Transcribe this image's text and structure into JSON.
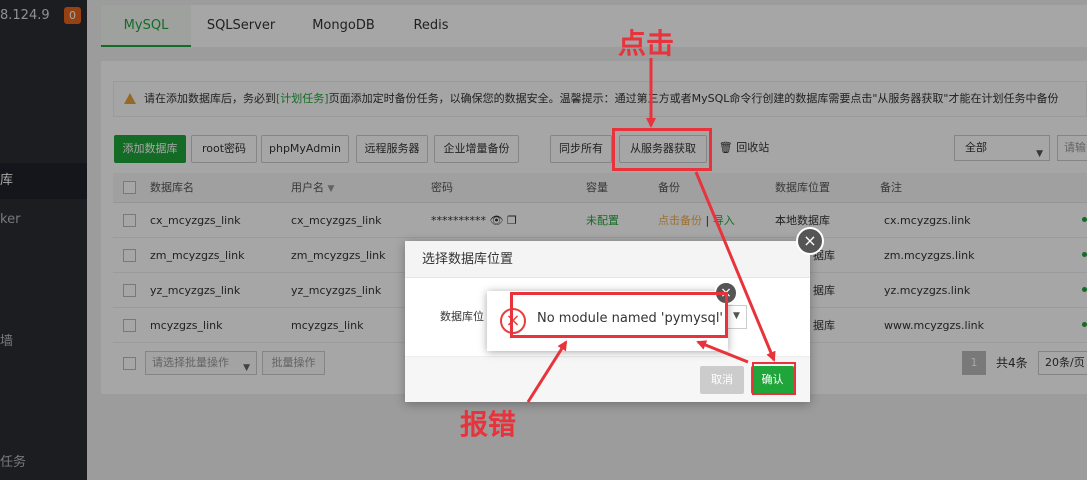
{
  "sidebar": {
    "ip": "8.124.9",
    "badge": "0",
    "items": [
      {
        "label": "库"
      },
      {
        "label": "ker"
      },
      {
        "label": "墙"
      },
      {
        "label": "任务"
      }
    ]
  },
  "tabs": [
    {
      "label": "MySQL"
    },
    {
      "label": "SQLServer"
    },
    {
      "label": "MongoDB"
    },
    {
      "label": "Redis"
    }
  ],
  "warning": {
    "prefix": "请在添加数据库后，务必到",
    "link": "[计划任务]",
    "suffix": "页面添加定时备份任务，以确保您的数据安全。温馨提示：通过第三方或者MySQL命令行创建的数据库需要点击\"从服务器获取\"才能在计划任务中备份"
  },
  "toolbar": {
    "add_db": "添加数据库",
    "root_pwd": "root密码",
    "phpmyadmin": "phpMyAdmin",
    "remote_server": "远程服务器",
    "enterprise_backup": "企业增量备份",
    "sync_all": "同步所有",
    "fetch_from_server": "从服务器获取",
    "recycle_bin": "回收站",
    "filter_all": "全部",
    "search_placeholder": "请输"
  },
  "table": {
    "headers": {
      "name": "数据库名",
      "user": "用户名",
      "password": "密码",
      "capacity": "容量",
      "backup": "备份",
      "location": "数据库位置",
      "note": "备注"
    },
    "rows": [
      {
        "name": "cx_mcyzgzs_link",
        "user": "cx_mcyzgzs_link",
        "password": "**********",
        "capacity": "未配置",
        "backup": "点击备份",
        "sep": "|",
        "import": "导入",
        "location": "本地数据库",
        "note": "cx.mcyzgzs.link"
      },
      {
        "name": "zm_mcyzgzs_link",
        "user": "zm_mcyzgzs_link",
        "location": "据库",
        "note": "zm.mcyzgzs.link"
      },
      {
        "name": "yz_mcyzgzs_link",
        "user": "yz_mcyzgzs_link",
        "location": "据库",
        "note": "yz.mcyzgzs.link"
      },
      {
        "name": "mcyzgzs_link",
        "user": "mcyzgzs_link",
        "location": "据库",
        "note": "www.mcyzgzs.link"
      }
    ]
  },
  "footer": {
    "batch_select": "请选择批量操作",
    "batch_button": "批量操作",
    "page": "1",
    "total": "共4条",
    "page_size": "20条/页"
  },
  "modal": {
    "title": "选择数据库位置",
    "label": "数据库位",
    "cancel": "取消",
    "confirm": "确认",
    "close": "×"
  },
  "toast": {
    "message": "No module named 'pymysql'",
    "close": "×"
  },
  "annotations": {
    "click": "点击",
    "error": "报错"
  },
  "colors": {
    "brand_green": "#20a53a",
    "annotation_red": "#e8333c",
    "sidebar_bg": "#2b2d33"
  }
}
